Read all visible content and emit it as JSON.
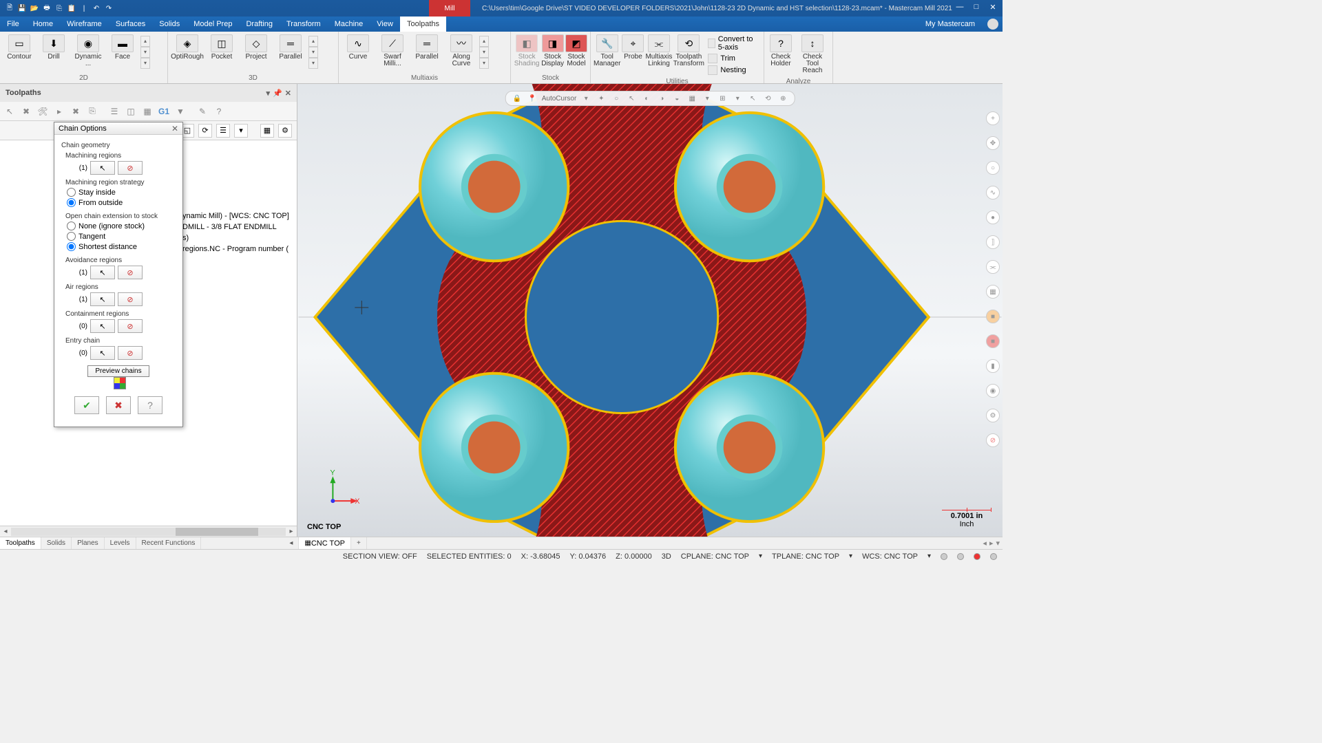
{
  "title": {
    "mill": "Mill",
    "path": "C:\\Users\\tim\\Google Drive\\ST VIDEO DEVELOPER FOLDERS\\2021\\John\\1128-23 2D Dynamic and HST selection\\1128-23.mcam* - Mastercam Mill 2021"
  },
  "menu": {
    "items": [
      "File",
      "Home",
      "Wireframe",
      "Surfaces",
      "Solids",
      "Model Prep",
      "Drafting",
      "Transform",
      "Machine",
      "View",
      "Toolpaths"
    ],
    "active_index": 10,
    "my_mc": "My Mastercam"
  },
  "ribbon": {
    "g2d": {
      "label": "2D",
      "items": [
        "Contour",
        "Drill",
        "Dynamic ...",
        "Face"
      ]
    },
    "g3d": {
      "label": "3D",
      "items": [
        "OptiRough",
        "Pocket",
        "Project",
        "Parallel"
      ]
    },
    "gmulti": {
      "label": "Multiaxis",
      "items": [
        "Curve",
        "Swarf Milli...",
        "Parallel",
        "Along Curve"
      ]
    },
    "gstock": {
      "label": "Stock",
      "items": [
        "Stock Shading",
        "Stock Display",
        "Stock Model"
      ]
    },
    "gutil": {
      "label": "Utilities",
      "items": [
        "Tool Manager",
        "Probe",
        "Multiaxis Linking",
        "Toolpath Transform"
      ],
      "side": [
        "Convert to 5-axis",
        "Trim",
        "Nesting"
      ]
    },
    "gana": {
      "label": "Analyze",
      "items": [
        "Check Holder",
        "Check Tool Reach"
      ]
    }
  },
  "panel": {
    "title": "Toolpaths",
    "g1": "G1",
    "tree_lines": [
      "ynamic Mill) - [WCS: CNC TOP]",
      "",
      "DMILL - 3/8 FLAT ENDMILL",
      "s)",
      " regions.NC - Program number ("
    ]
  },
  "dialog": {
    "title": "Chain Options",
    "chain_geometry": "Chain geometry",
    "machining_regions": {
      "label": "Machining regions",
      "count": "(1)"
    },
    "strategy": {
      "label": "Machining region strategy",
      "stay_inside": "Stay inside",
      "from_outside": "From outside",
      "selected": "from_outside"
    },
    "open_chain": {
      "label": "Open chain extension to stock",
      "none": "None (ignore stock)",
      "tangent": "Tangent",
      "shortest": "Shortest distance",
      "selected": "shortest"
    },
    "avoidance": {
      "label": "Avoidance regions",
      "count": "(1)"
    },
    "air": {
      "label": "Air regions",
      "count": "(1)"
    },
    "containment": {
      "label": "Containment regions",
      "count": "(0)"
    },
    "entry": {
      "label": "Entry chain",
      "count": "(0)"
    },
    "preview": "Preview chains"
  },
  "viewport": {
    "autocursor": "AutoCursor",
    "axis_label": "CNC TOP",
    "scale_value": "0.7001 in",
    "scale_unit": "Inch",
    "y": "Y",
    "x": "X"
  },
  "bottom_tabs_left": [
    "Toolpaths",
    "Solids",
    "Planes",
    "Levels",
    "Recent Functions"
  ],
  "bottom_tabs_left_active": 0,
  "bottom_tab_vp": "CNC TOP",
  "status": {
    "section": "SECTION VIEW: OFF",
    "selected": "SELECTED ENTITIES: 0",
    "x": "X: -3.68045",
    "y": "Y: 0.04376",
    "z": "Z: 0.00000",
    "mode": "3D",
    "cplane": "CPLANE: CNC TOP",
    "tplane": "TPLANE: CNC TOP",
    "wcs": "WCS: CNC TOP"
  }
}
